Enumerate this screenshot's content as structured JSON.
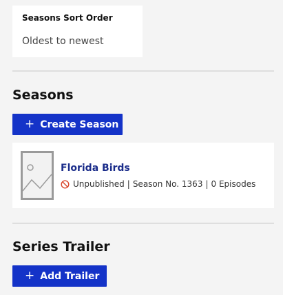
{
  "sort_order": {
    "label": "Seasons Sort Order",
    "value": "Oldest to newest"
  },
  "seasons_section": {
    "title": "Seasons",
    "create_button_label": "Create Season",
    "items": [
      {
        "title": "Florida Birds",
        "status": "Unpublished",
        "season_no": "Season No. 1363",
        "episodes": "0 Episodes",
        "separator": "|"
      }
    ]
  },
  "trailer_section": {
    "title": "Series Trailer",
    "add_button_label": "Add Trailer"
  },
  "colors": {
    "primary": "#1433c8",
    "link": "#1a2c8a",
    "unpublished_icon": "#d9452a",
    "placeholder": "#9a9a9a"
  },
  "icons": {
    "plus": "plus-icon",
    "unpublished": "unpublished-icon",
    "placeholder": "image-placeholder-icon"
  }
}
